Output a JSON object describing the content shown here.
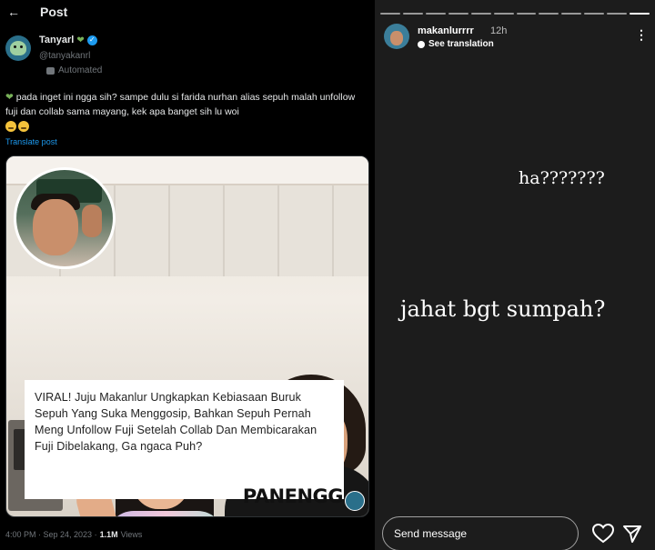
{
  "left": {
    "header": {
      "title": "Post",
      "back_icon": "arrow-left-icon"
    },
    "author": {
      "name": "Tanyarl",
      "handle": "@tanyakanrl",
      "automated_label": "Automated",
      "verified": true,
      "heart_color": "#78b159"
    },
    "tweet": {
      "text": "pada inget ini ngga sih? sampe dulu si farida nurhan alias sepuh malah unfollow fuji dan collab sama mayang, kek apa banget sih lu woi",
      "translate_label": "Translate post"
    },
    "media": {
      "caption": "VIRAL! Juju Makanlur Ungkapkan Kebiasaan Buruk Sepuh Yang Suka Menggosip, Bahkan Sepuh Pernah Meng Unfollow Fuji Setelah Collab Dan Membicarakan Fuji Dibelakang, Ga ngaca Puh?",
      "brand": "PANENGG"
    },
    "meta": {
      "time": "4:00 PM · Sep 24, 2023 ·",
      "views_count": "1.1M",
      "views_label": "Views"
    }
  },
  "right": {
    "story": {
      "username": "makanlurrrr",
      "time": "12h",
      "see_translation": "See translation",
      "segments": 12,
      "active_segment": 12,
      "text_1": "ha???????",
      "text_2": "jahat bgt sumpah?"
    },
    "footer": {
      "message_placeholder": "Send message"
    }
  },
  "colors": {
    "link_blue": "#1d9bf0",
    "muted_gray": "#71767b",
    "story_bg": "#1c1c1c"
  }
}
